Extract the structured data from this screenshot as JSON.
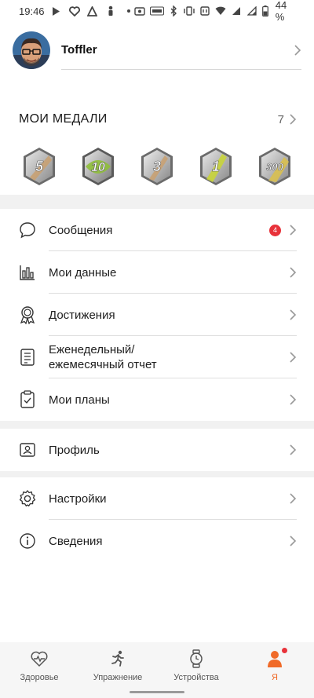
{
  "status_bar": {
    "time": "19:46",
    "battery": "44 %",
    "icons": [
      "play-store-icon",
      "heart-icon",
      "strava-icon",
      "figure-icon",
      "dot-icon",
      "screenshot-icon",
      "auto-icon",
      "bluetooth-icon",
      "vibrate-icon",
      "nfc-icon",
      "wifi-icon",
      "signal-icon",
      "signal-2-icon",
      "battery-icon"
    ]
  },
  "profile": {
    "name": "Toffler"
  },
  "medals": {
    "title": "МОИ МЕДАЛИ",
    "count": "7",
    "items": [
      {
        "label": "5",
        "color": "#c9a070"
      },
      {
        "label": "10",
        "color": "#8fbf3a"
      },
      {
        "label": "3",
        "color": "#c9a070"
      },
      {
        "label": "1",
        "color": "#c8d43a"
      },
      {
        "label": "300",
        "color": "#d9c050"
      }
    ]
  },
  "menu_group1": [
    {
      "label": "Сообщения",
      "icon": "chat-bubble-icon",
      "badge": "4"
    },
    {
      "label": "Мои данные",
      "icon": "bar-chart-icon"
    },
    {
      "label": "Достижения",
      "icon": "award-icon"
    },
    {
      "label_line1": "Еженедельный/",
      "label_line2": "ежемесячный отчет",
      "icon": "report-icon"
    },
    {
      "label": "Мои планы",
      "icon": "clipboard-check-icon"
    }
  ],
  "menu_group2": [
    {
      "label": "Профиль",
      "icon": "id-card-icon"
    }
  ],
  "menu_group3": [
    {
      "label": "Настройки",
      "icon": "gear-icon"
    },
    {
      "label": "Сведения",
      "icon": "info-icon"
    }
  ],
  "bottom_nav": {
    "items": [
      {
        "label": "Здоровье",
        "icon": "heart-pulse-icon"
      },
      {
        "label": "Упражнение",
        "icon": "running-icon"
      },
      {
        "label": "Устройства",
        "icon": "watch-icon"
      },
      {
        "label": "Я",
        "icon": "person-icon",
        "active": true
      }
    ]
  },
  "colors": {
    "accent": "#f06a28",
    "badge": "#e8323a",
    "band": "#f1f1f1"
  }
}
